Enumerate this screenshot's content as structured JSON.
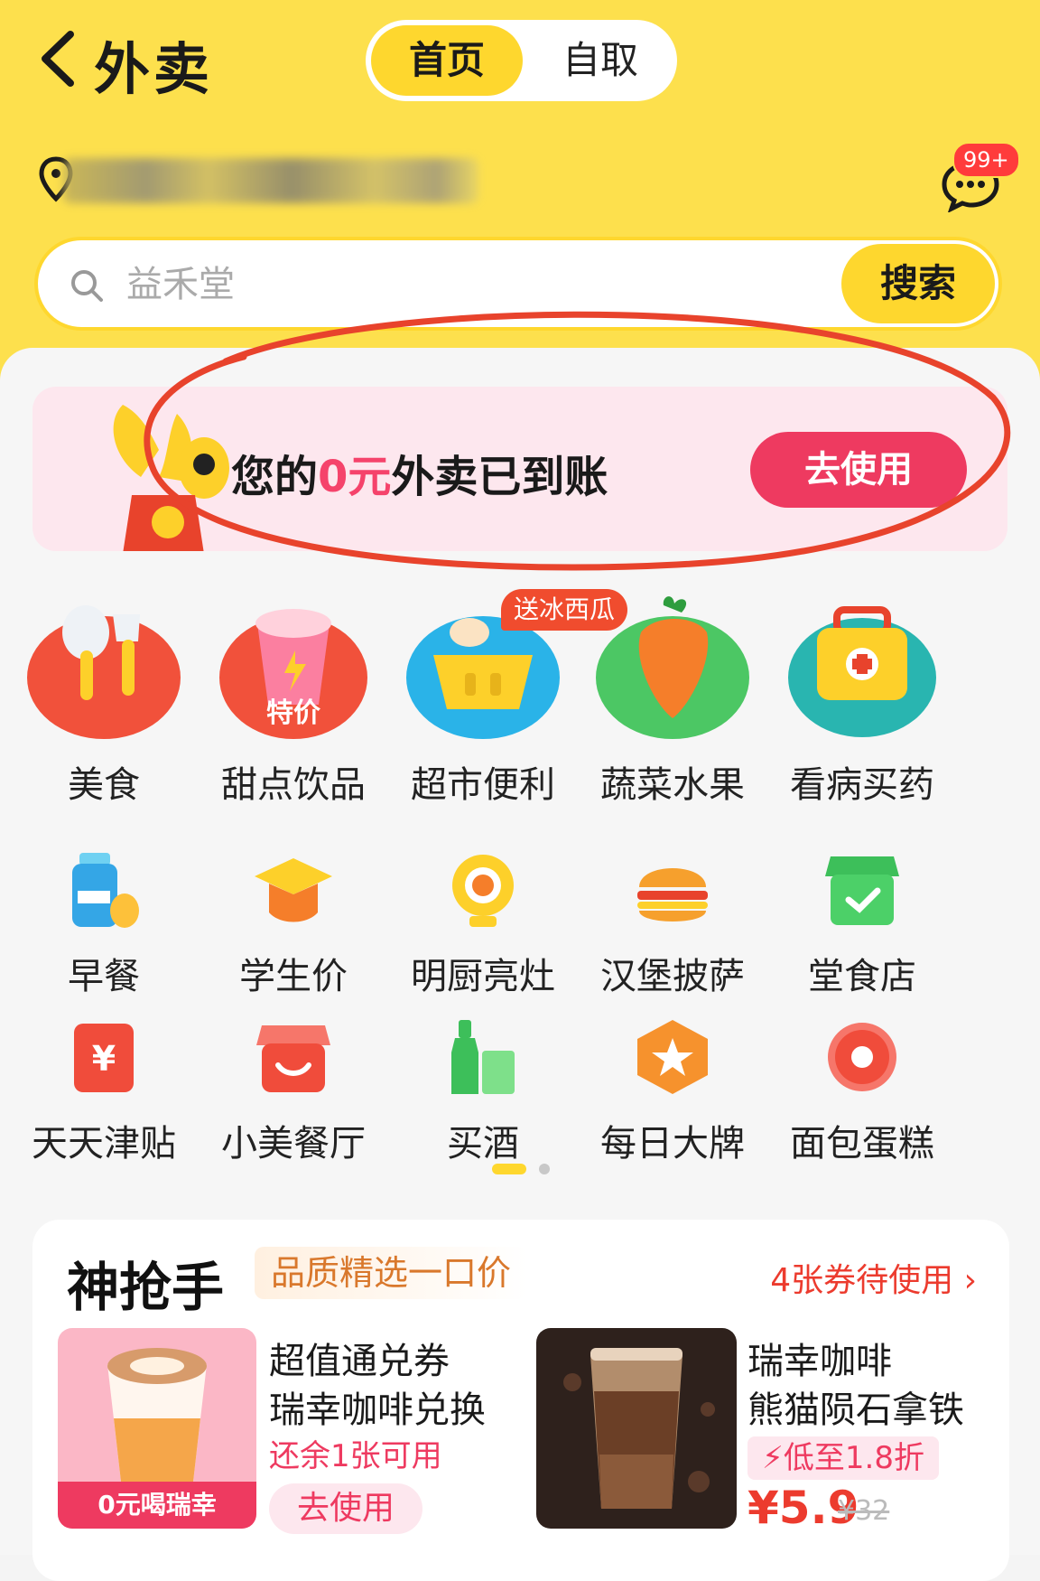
{
  "header": {
    "back_icon": "chevron-left-icon",
    "title": "外卖",
    "tabs": [
      {
        "label": "首页",
        "active": true
      },
      {
        "label": "自取",
        "active": false
      }
    ],
    "message_badge": "99+",
    "accent_color": "#fde04d"
  },
  "search": {
    "placeholder": "益禾堂",
    "button_label": "搜索"
  },
  "promo": {
    "text_before": "您的",
    "text_highlight": "0元",
    "text_after": "外卖已到账",
    "button_label": "去使用",
    "button_color": "#ee3a60"
  },
  "categories_big": [
    {
      "label": "美食",
      "icon": "utensils-icon"
    },
    {
      "label": "甜点饮品",
      "icon": "drink-cup-icon",
      "tag": "特价"
    },
    {
      "label": "超市便利",
      "icon": "basket-icon"
    },
    {
      "label": "蔬菜水果",
      "icon": "carrot-icon"
    },
    {
      "label": "看病买药",
      "icon": "medical-kit-icon"
    }
  ],
  "watermelon_badge": "送冰西瓜",
  "categories_row2": [
    {
      "label": "早餐",
      "icon": "milk-bottle-icon"
    },
    {
      "label": "学生价",
      "icon": "graduation-cap-icon"
    },
    {
      "label": "明厨亮灶",
      "icon": "camera-icon"
    },
    {
      "label": "汉堡披萨",
      "icon": "burger-icon"
    },
    {
      "label": "堂食店",
      "icon": "store-check-icon"
    }
  ],
  "categories_row3": [
    {
      "label": "天天津贴",
      "icon": "yen-envelope-icon"
    },
    {
      "label": "小美餐厅",
      "icon": "smile-store-icon"
    },
    {
      "label": "买酒",
      "icon": "bottle-icon"
    },
    {
      "label": "每日大牌",
      "icon": "star-hexagon-icon"
    },
    {
      "label": "面包蛋糕",
      "icon": "donut-icon"
    }
  ],
  "flash_sale": {
    "title": "神抢手",
    "subtitle": "品质精选一口价",
    "coupon_link": "4张券待使用 ›",
    "product1": {
      "image_label": "0元喝瑞幸",
      "name": "超值通兑券",
      "desc": "瑞幸咖啡兑换",
      "remain": "还余1张可用",
      "button": "去使用"
    },
    "product2": {
      "name": "瑞幸咖啡",
      "desc": "熊猫陨石拿铁",
      "discount": "低至1.8折",
      "price": "¥5.9",
      "original_price": "¥32"
    }
  }
}
